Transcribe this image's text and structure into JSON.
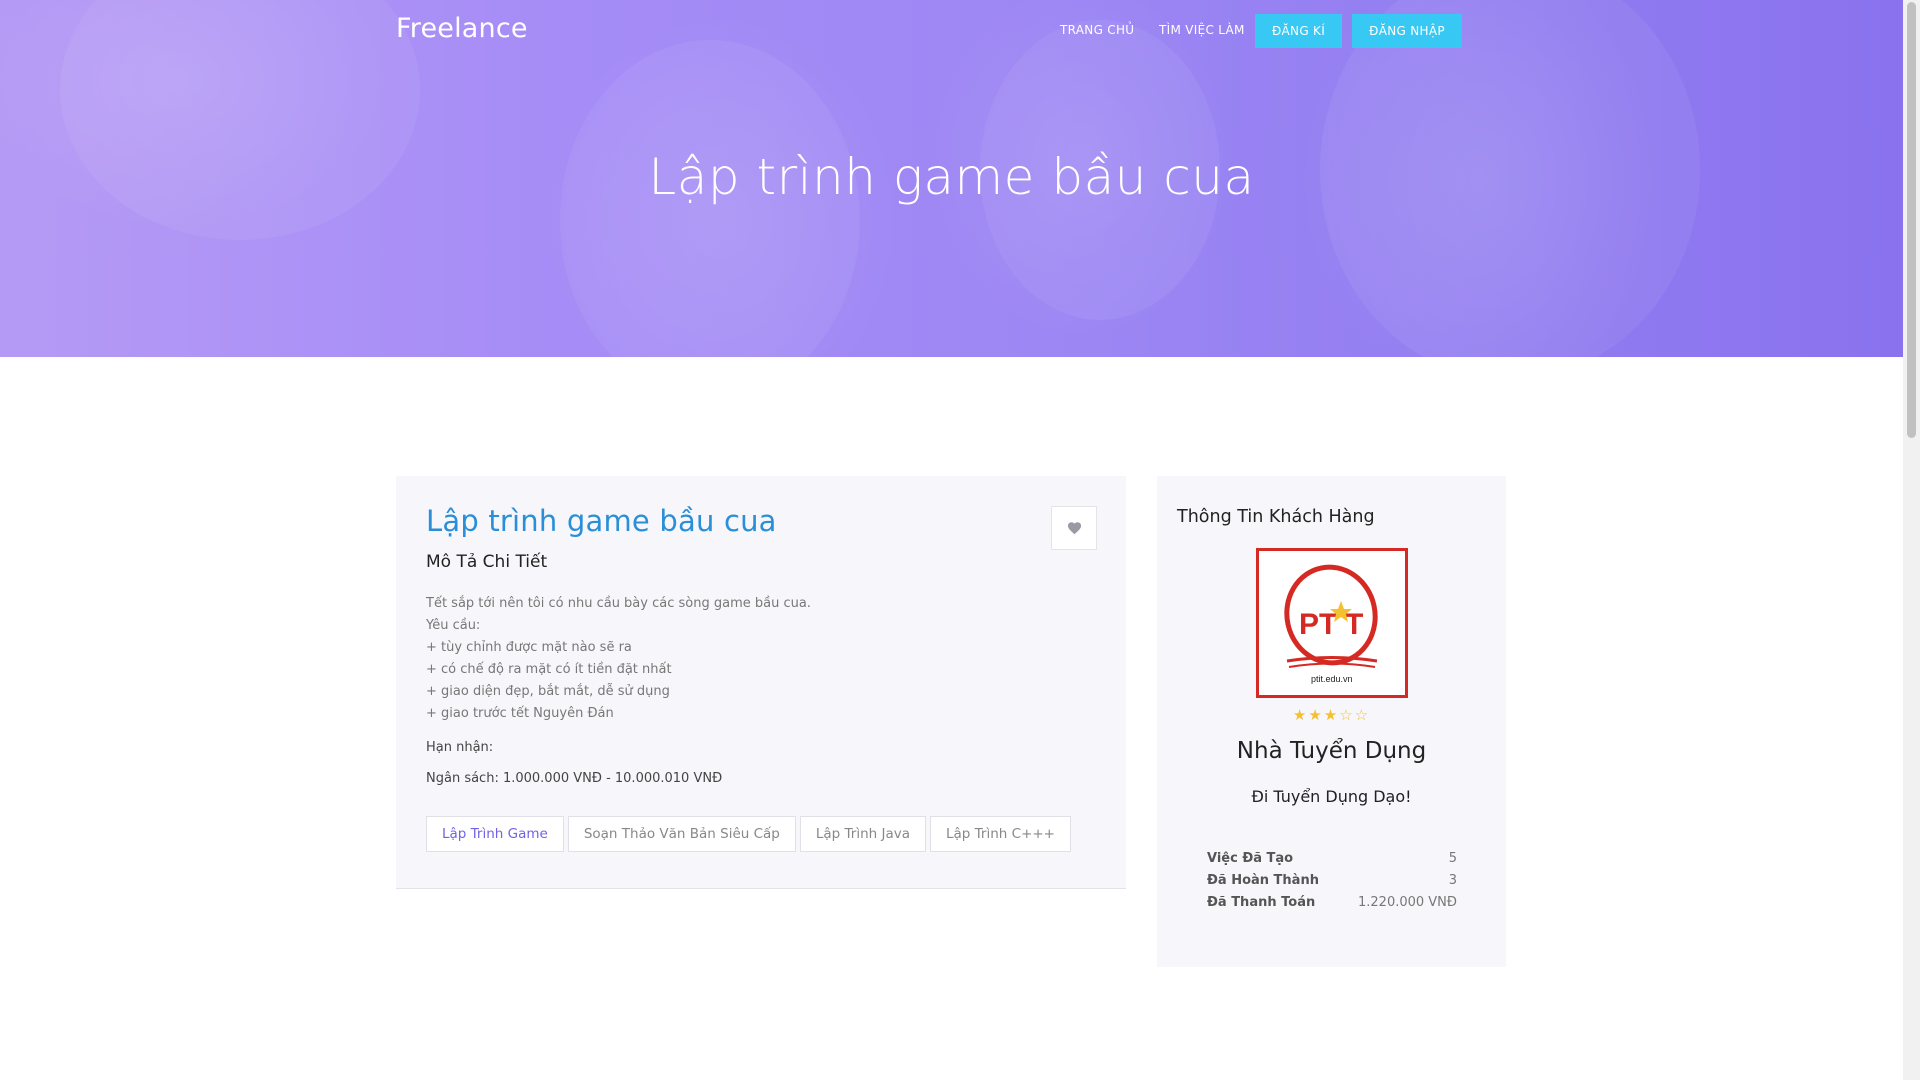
{
  "navbar": {
    "brand": "Freelance",
    "links": [
      "TRANG CHỦ",
      "TÌM VIỆC LÀM"
    ],
    "register_label": "ĐĂNG KÍ",
    "login_label": "ĐĂNG NHẬP"
  },
  "hero": {
    "title": "Lập trình game bầu cua"
  },
  "job": {
    "title": "Lập trình game bầu cua",
    "subtitle": "Mô Tả Chi Tiết",
    "description": [
      "Tết sắp tới nên tôi có nhu cầu bày các sòng game bầu cua.",
      "Yêu cầu:",
      "+ tùy chỉnh được mặt nào sẽ ra",
      "+ có chế độ ra mặt có ít tiền đặt nhất",
      "+ giao diện đẹp, bắt mắt, dễ sử dụng",
      "+ giao trước tết Nguyên Đán"
    ],
    "deadline": "Hạn nhận:",
    "budget": "Ngân sách: 1.000.000 VNĐ - 10.000.010 VNĐ",
    "tags": [
      "Lập Trình Game",
      "Soạn Thảo Văn Bản Siêu Cấp",
      "Lập Trình Java",
      "Lập Trình C+++"
    ],
    "favorite_icon": "heart-icon"
  },
  "client": {
    "title": "Thông Tin Khách Hàng",
    "logo_text": "PTIT",
    "logo_subtext": "ptit.edu.vn",
    "rating": 3,
    "rating_max": 5,
    "company": "Nhà Tuyển Dụng",
    "slogan": "Đi Tuyển Dụng Dạo!",
    "stats": [
      {
        "label": "Việc Đã Tạo",
        "value": "5"
      },
      {
        "label": "Đã Hoàn Thành",
        "value": "3"
      },
      {
        "label": "Đã Thanh Toán",
        "value": "1.220.000 VNĐ"
      }
    ]
  },
  "colors": {
    "accent": "#37c9f4",
    "title_blue": "#2b8fd7",
    "hero_purple": "#9d87f4",
    "logo_red": "#d42a23",
    "star_yellow": "#f4c02f"
  }
}
